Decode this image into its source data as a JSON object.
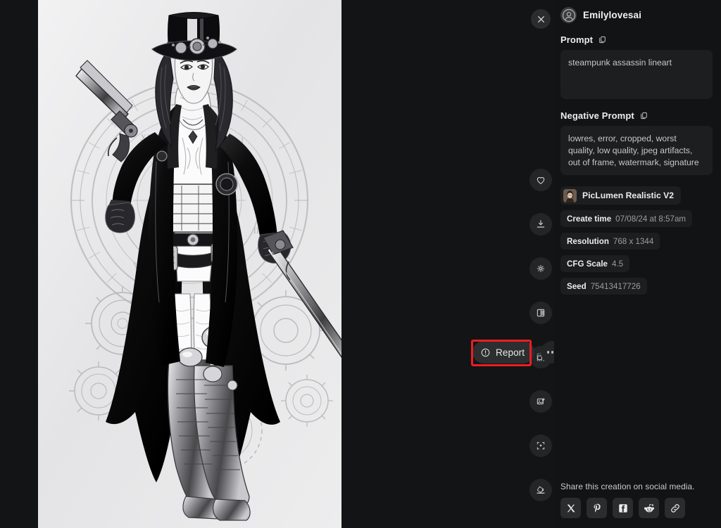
{
  "window": {
    "background_color": "#111314",
    "panel_color": "#111314",
    "viewer_color": "#121415"
  },
  "viewer": {
    "close_label": "Close",
    "close_icon": "close-icon",
    "artwork_alt": "steampunk assassin lineart illustration of a woman in a top hat holding revolvers, clock and gears background",
    "rail": [
      {
        "id": "favorite",
        "icon": "heart-icon",
        "label": "Favorite"
      },
      {
        "id": "download",
        "icon": "download-icon",
        "label": "Download"
      },
      {
        "id": "enhance",
        "icon": "sparkle-icon",
        "label": "Enhance"
      },
      {
        "id": "compare",
        "icon": "compare-split-icon",
        "label": "Compare"
      },
      {
        "id": "expand",
        "icon": "expand-image-icon",
        "label": "Expand"
      },
      {
        "id": "edit",
        "icon": "edit-image-icon",
        "label": "Edit"
      },
      {
        "id": "upscale",
        "icon": "upscale-icon",
        "label": "Upscale"
      },
      {
        "id": "remove-background",
        "icon": "paint-bucket-icon",
        "label": "Remove background"
      }
    ],
    "report": {
      "label": "Report",
      "icon": "warning-circle-icon",
      "highlighted": true,
      "highlight_color": "#ee1c20"
    },
    "more": {
      "label": "More options",
      "icon": "more-dots-icon"
    }
  },
  "panel": {
    "user": {
      "name": "Emilylovesai",
      "avatar_icon": "user-avatar-icon"
    },
    "prompt": {
      "label": "Prompt",
      "copy_icon": "copy-icon",
      "value": "steampunk assassin lineart"
    },
    "negative_prompt": {
      "label": "Negative Prompt",
      "copy_icon": "copy-icon",
      "value": "lowres, error, cropped, worst quality, low quality, jpeg artifacts, out of frame, watermark, signature"
    },
    "model": {
      "name": "PicLumen Realistic V2",
      "thumb_icon": "model-thumbnail"
    },
    "meta": {
      "create_time_key": "Create time",
      "create_time_value": "07/08/24 at 8:57am",
      "resolution_key": "Resolution",
      "resolution_value": "768 x 1344",
      "cfg_key": "CFG Scale",
      "cfg_value": "4.5",
      "seed_key": "Seed",
      "seed_value": "75413417726"
    },
    "share": {
      "label": "Share this creation on social media.",
      "items": [
        {
          "id": "x",
          "icon": "x-twitter-icon",
          "label": "X"
        },
        {
          "id": "pinterest",
          "icon": "pinterest-icon",
          "label": "Pinterest"
        },
        {
          "id": "facebook",
          "icon": "facebook-icon",
          "label": "Facebook"
        },
        {
          "id": "reddit",
          "icon": "reddit-icon",
          "label": "Reddit"
        },
        {
          "id": "copy-link",
          "icon": "link-icon",
          "label": "Copy link"
        }
      ]
    }
  }
}
